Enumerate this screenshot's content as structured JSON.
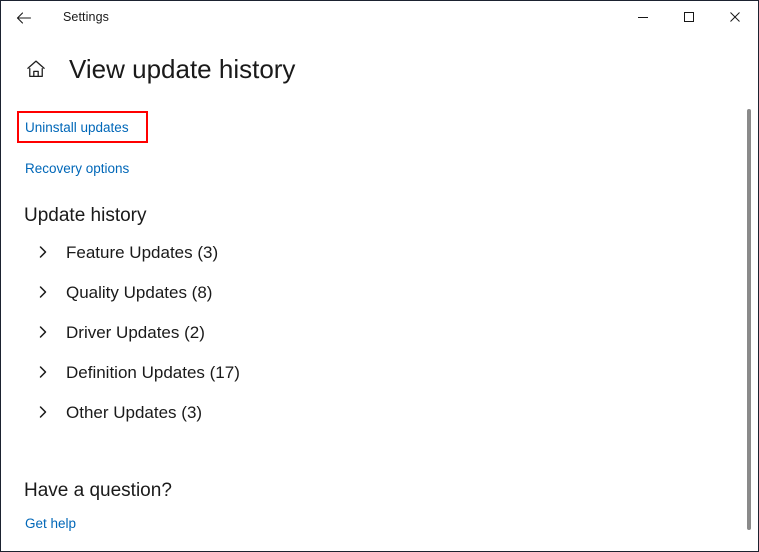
{
  "window": {
    "title": "Settings",
    "back_icon": "back-arrow-icon",
    "controls": {
      "minimize_label": "Minimize",
      "maximize_label": "Maximize",
      "close_label": "Close"
    }
  },
  "page": {
    "home_icon": "home-icon",
    "title": "View update history"
  },
  "links": {
    "uninstall_updates": "Uninstall updates",
    "recovery_options": "Recovery options",
    "get_help": "Get help"
  },
  "highlight": {
    "target": "Uninstall updates",
    "color": "#ff0000"
  },
  "sections": {
    "update_history_heading": "Update history",
    "have_question_heading": "Have a question?"
  },
  "update_history": {
    "items": [
      {
        "label": "Feature Updates (3)",
        "name": "feature-updates",
        "count": 3,
        "expanded": false
      },
      {
        "label": "Quality Updates (8)",
        "name": "quality-updates",
        "count": 8,
        "expanded": false
      },
      {
        "label": "Driver Updates (2)",
        "name": "driver-updates",
        "count": 2,
        "expanded": false
      },
      {
        "label": "Definition Updates (17)",
        "name": "definition-updates",
        "count": 17,
        "expanded": false
      },
      {
        "label": "Other Updates (3)",
        "name": "other-updates",
        "count": 3,
        "expanded": false
      }
    ]
  },
  "colors": {
    "link": "#0067b8",
    "text": "#1a1a1a",
    "background": "#ffffff",
    "highlight": "#ff0000",
    "scrollbar_thumb": "#8a8a8a",
    "window_border": "#1b2230"
  },
  "scrollbar": {
    "orientation": "vertical",
    "position_percent": 8
  }
}
